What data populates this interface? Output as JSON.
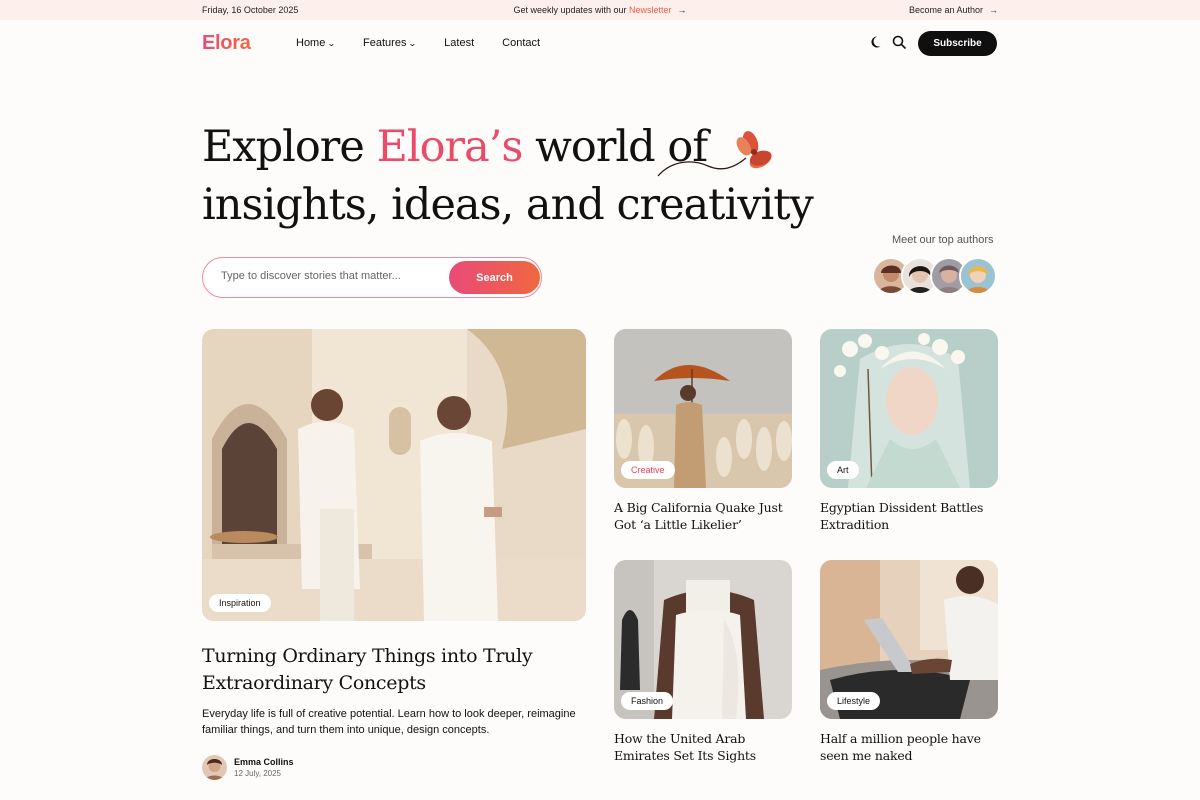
{
  "topbar": {
    "date": "Friday, 16 October 2025",
    "promo_prefix": "Get weekly updates with our ",
    "promo_link": "Newsletter",
    "author_link": "Become an Author",
    "arrow": "→"
  },
  "nav": {
    "logo": "Elora",
    "items": [
      {
        "label": "Home",
        "dropdown": "⌄"
      },
      {
        "label": "Features",
        "dropdown": "⌄"
      },
      {
        "label": "Latest"
      },
      {
        "label": "Contact"
      }
    ],
    "icons": [
      "moon-icon",
      "search-icon"
    ],
    "subscribe_label": "Subscribe"
  },
  "hero": {
    "title_part1": "Explore ",
    "title_accent": "Elora’s",
    "title_part2": " world of",
    "title_line2": "insights, ideas, and creativity",
    "search_placeholder": "Type to discover stories that matter...",
    "search_button": "Search",
    "top_authors_label": "Meet our top authors"
  },
  "featured": {
    "tag": "Inspiration",
    "title": "Turning Ordinary Things into Truly Extraordinary Concepts",
    "excerpt": "Everyday life is full of creative potential. Learn how to look deeper, reimagine familiar things, and turn them into unique, design concepts.",
    "author": "Emma Collins",
    "date": "12 July, 2025"
  },
  "cards": [
    {
      "tag": "Creative",
      "title": "A Big California Quake Just Got ‘a Little Likelier’"
    },
    {
      "tag": "Art",
      "title": "Egyptian Dissident Battles Extradition"
    },
    {
      "tag": "Fashion",
      "title": "How the United Arab Emirates Set Its Sights"
    },
    {
      "tag": "Lifestyle",
      "title": "Half a million people have seen me naked"
    }
  ],
  "colors": {
    "accent_pink": "#e94c6a",
    "accent_orange": "#f0683f",
    "topbar_bg": "#fdf0ec",
    "dark": "#0f0f0f"
  }
}
